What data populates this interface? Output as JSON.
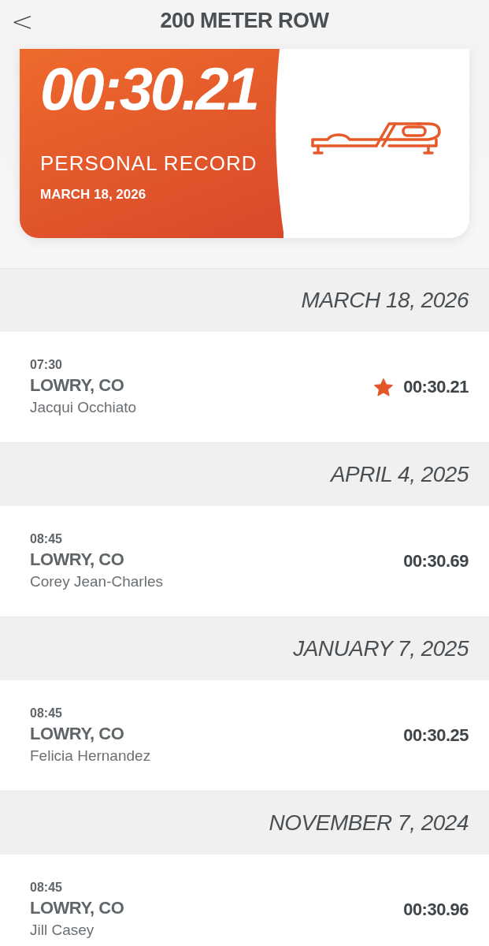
{
  "header": {
    "back": "<",
    "title": "200 METER ROW"
  },
  "record": {
    "time": "00:30.21",
    "label": "PERSONAL RECORD",
    "date": "MARCH 18, 2026"
  },
  "sessions": [
    {
      "date": "MARCH 18, 2026",
      "time": "07:30",
      "location": "LOWRY, CO",
      "coach": "Jacqui Occhiato",
      "result": "00:30.21",
      "personal_record": true
    },
    {
      "date": "APRIL 4, 2025",
      "time": "08:45",
      "location": "LOWRY, CO",
      "coach": "Corey Jean-Charles",
      "result": "00:30.69",
      "personal_record": false
    },
    {
      "date": "JANUARY 7, 2025",
      "time": "08:45",
      "location": "LOWRY, CO",
      "coach": "Felicia Hernandez",
      "result": "00:30.25",
      "personal_record": false
    },
    {
      "date": "NOVEMBER 7, 2024",
      "time": "08:45",
      "location": "LOWRY, CO",
      "coach": "Jill Casey",
      "result": "00:30.96",
      "personal_record": false
    }
  ]
}
